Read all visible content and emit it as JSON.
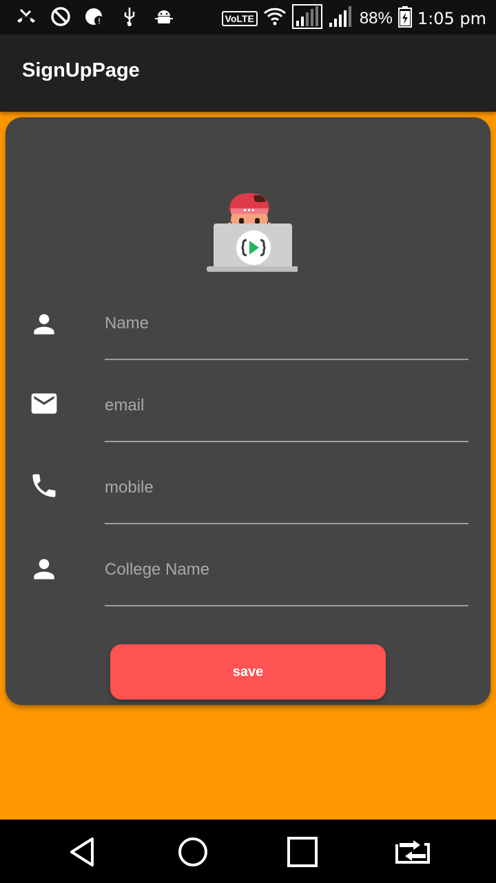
{
  "status_bar": {
    "volte": "VoLTE",
    "battery_percent": "88%",
    "time": "1:05 pm",
    "icons": [
      "missed-call-icon",
      "do-not-disturb-icon",
      "data-saver-icon",
      "usb-icon",
      "android-debug-icon"
    ]
  },
  "app_bar": {
    "title": "SignUpPage"
  },
  "form": {
    "fields": [
      {
        "placeholder": "Name",
        "value": "",
        "icon": "person-icon"
      },
      {
        "placeholder": "email",
        "value": "",
        "icon": "email-icon"
      },
      {
        "placeholder": "mobile",
        "value": "",
        "icon": "phone-icon"
      },
      {
        "placeholder": "College Name",
        "value": "",
        "icon": "person-icon"
      }
    ],
    "save_label": "save"
  },
  "nav_bar": {
    "icons": [
      "back-icon",
      "home-icon",
      "recents-icon",
      "switch-app-icon"
    ]
  },
  "colors": {
    "background": "#FF9800",
    "app_bar": "#212121",
    "card": "#454545",
    "save_button": "#FF5252"
  }
}
